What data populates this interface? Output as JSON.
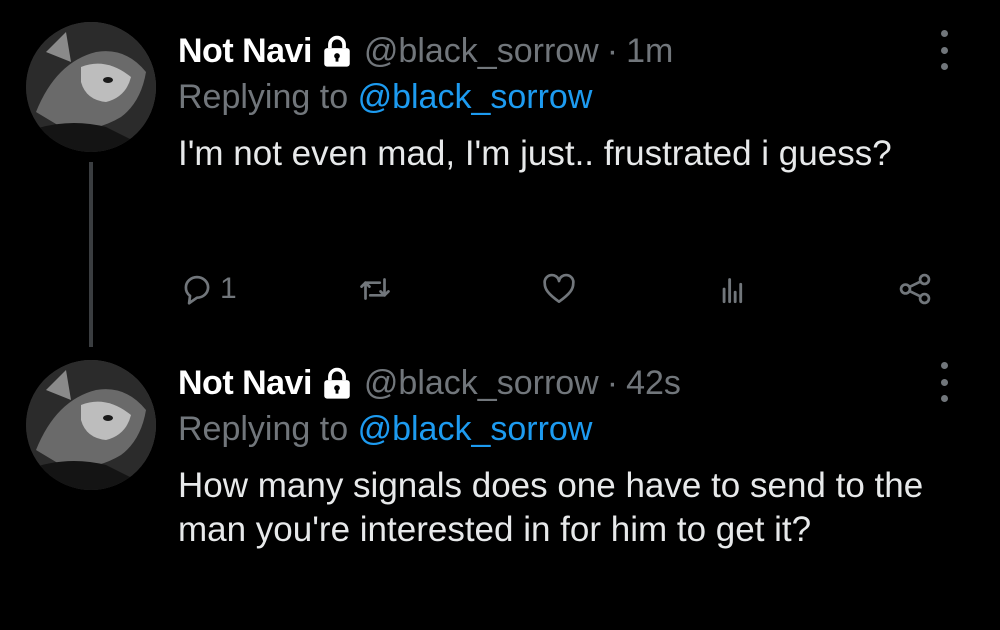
{
  "tweets": [
    {
      "author_name": "Not Navi",
      "handle": "@black_sorrow",
      "separator": "·",
      "time": "1m",
      "replying_prefix": "Replying to",
      "replying_to": "@black_sorrow",
      "text": "I'm not even mad, I'm just.. frustrated i guess?",
      "reply_count": "1"
    },
    {
      "author_name": "Not Navi",
      "handle": "@black_sorrow",
      "separator": "·",
      "time": "42s",
      "replying_prefix": "Replying to",
      "replying_to": "@black_sorrow",
      "text": "How many signals does one have to send to the man you're interested in for him to get it?"
    }
  ],
  "colors": {
    "background": "#000000",
    "text_primary": "#e7e9ea",
    "text_secondary": "#71767b",
    "accent": "#1d9bf0",
    "thread_line": "#3a3d40"
  },
  "icons": [
    "lock-icon",
    "more-icon",
    "reply-icon",
    "retweet-icon",
    "like-icon",
    "stats-icon",
    "share-icon"
  ]
}
